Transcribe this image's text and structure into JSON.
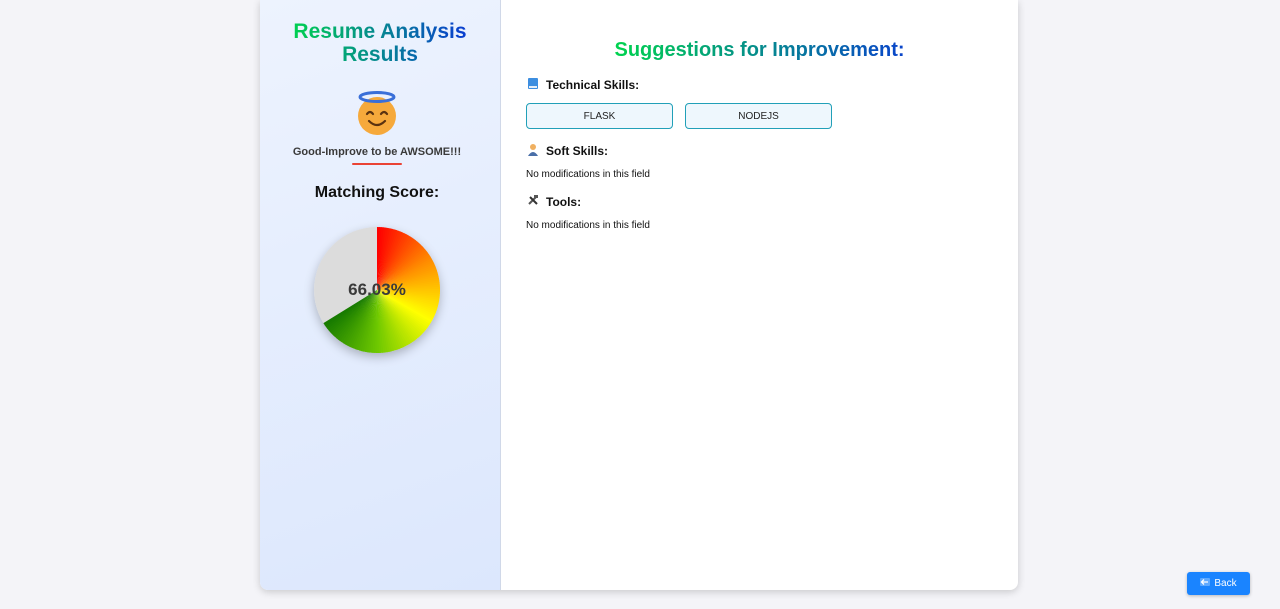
{
  "left_panel": {
    "title": "Resume Analysis Results",
    "emoji_icon": "smiling-face-with-halo",
    "status_text": "Good-Improve to be AWSOME!!!",
    "score_label": "Matching Score:",
    "score_display": "66.03%",
    "score_value": 66.03
  },
  "right_panel": {
    "title": "Suggestions for Improvement:",
    "technical": {
      "icon": "blue-book-icon",
      "label": "Technical Skills:",
      "tags": [
        "FLASK",
        "NODEJS"
      ]
    },
    "soft": {
      "icon": "person-icon",
      "label": "Soft Skills:",
      "note": "No modifications in this field"
    },
    "tools": {
      "icon": "hammer-wrench-icon",
      "label": "Tools:",
      "note": "No modifications in this field"
    }
  },
  "back_button": {
    "icon": "left-arrow-icon",
    "label": "Back"
  },
  "colors": {
    "accent_green": "#00d84a",
    "accent_blue": "#0a3fcf",
    "button_blue": "#1a84ff",
    "tag_border": "#21a0b8"
  }
}
